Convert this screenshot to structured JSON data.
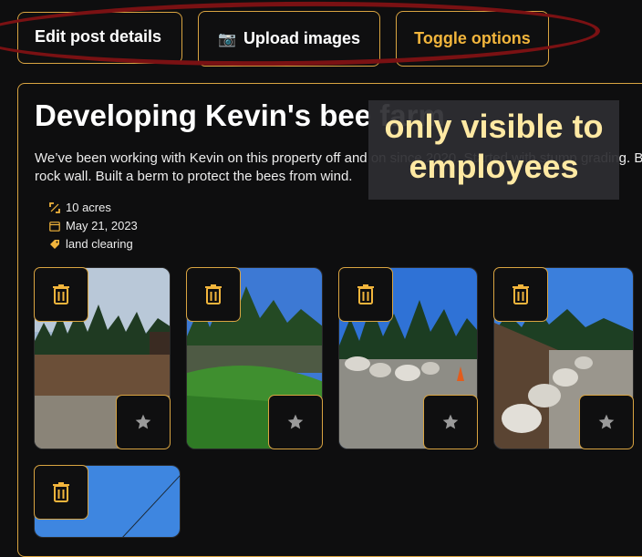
{
  "toolbar": {
    "edit_label": "Edit post details",
    "upload_label": "Upload images",
    "upload_icon": "📷",
    "toggle_label": "Toggle options"
  },
  "post": {
    "title": "Developing Kevin's bee farm",
    "description": "We’ve been working with Kevin on this property off and on since 2020. Started with stump grading. Built a rock wall. Built a berm to protect the bees from wind.",
    "meta": {
      "area": "10 acres",
      "date": "May 21, 2023",
      "tag": "land clearing"
    }
  },
  "overlay": {
    "text": "only visible to employees"
  },
  "photos": [
    {
      "scene": "cleared-lot-with-barn",
      "delete_icon": "trash-icon",
      "favorite_icon": "star-icon"
    },
    {
      "scene": "green-slope-with-trees",
      "delete_icon": "trash-icon",
      "favorite_icon": "star-icon"
    },
    {
      "scene": "boulders-on-gravel",
      "delete_icon": "trash-icon",
      "favorite_icon": "star-icon"
    },
    {
      "scene": "boulder-rock-wall",
      "delete_icon": "trash-icon",
      "favorite_icon": "star-icon"
    },
    {
      "scene": "blue-sky-power-line",
      "delete_icon": "trash-icon"
    }
  ],
  "colors": {
    "accent": "#f2b53c",
    "border": "#d9a441",
    "background": "#0e0e0f",
    "annotation": "#7a1113",
    "overlay_text": "#ffe9a3"
  }
}
